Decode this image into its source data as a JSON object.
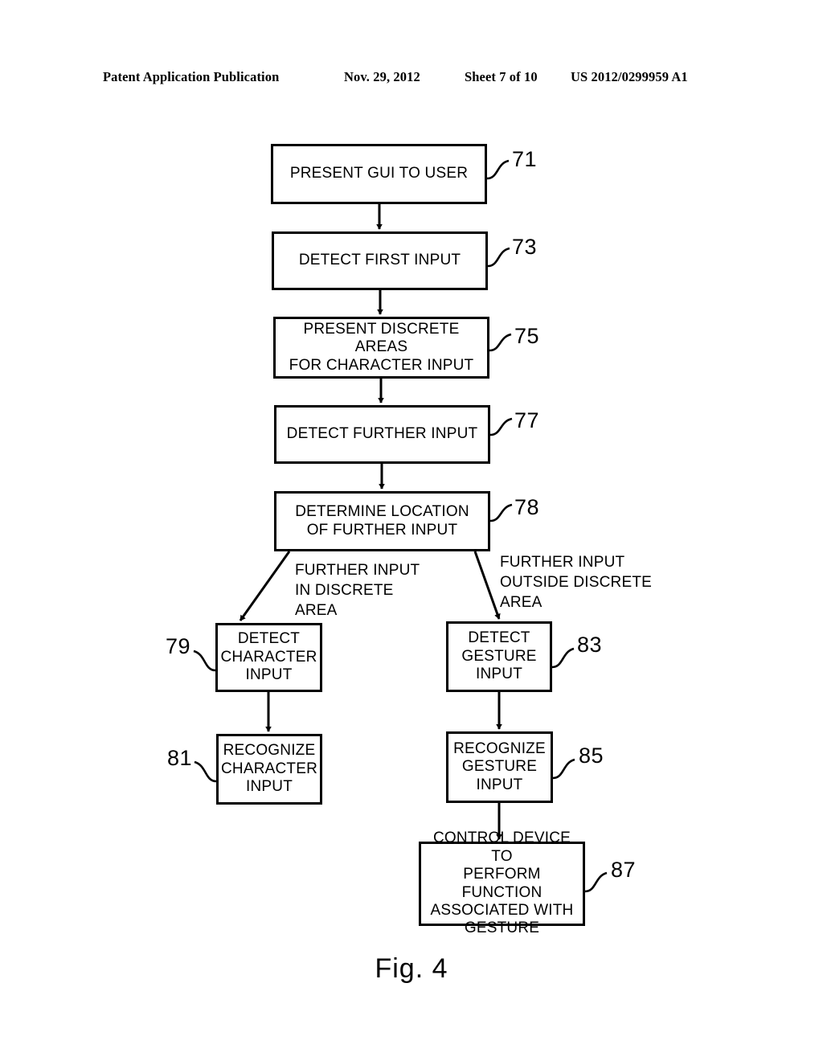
{
  "header": {
    "publication": "Patent Application Publication",
    "date": "Nov. 29, 2012",
    "sheet": "Sheet 7 of 10",
    "publication_number": "US 2012/0299959 A1"
  },
  "figure": {
    "caption": "Fig. 4",
    "type": "flowchart"
  },
  "nodes": [
    {
      "ref": "71",
      "label": "PRESENT GUI TO USER"
    },
    {
      "ref": "73",
      "label": "DETECT FIRST INPUT"
    },
    {
      "ref": "75",
      "label": "PRESENT DISCRETE AREAS\nFOR CHARACTER INPUT"
    },
    {
      "ref": "77",
      "label": "DETECT FURTHER INPUT"
    },
    {
      "ref": "78",
      "label": "DETERMINE LOCATION\nOF FURTHER INPUT"
    },
    {
      "ref": "79",
      "label": "DETECT\nCHARACTER\nINPUT"
    },
    {
      "ref": "81",
      "label": "RECOGNIZE\nCHARACTER\nINPUT"
    },
    {
      "ref": "83",
      "label": "DETECT\nGESTURE\nINPUT"
    },
    {
      "ref": "85",
      "label": "RECOGNIZE\nGESTURE\nINPUT"
    },
    {
      "ref": "87",
      "label": "CONTROL DEVICE TO\nPERFORM FUNCTION\nASSOCIATED WITH\nGESTURE"
    }
  ],
  "branch_labels": {
    "left": "FURTHER INPUT\nIN DISCRETE\nAREA",
    "right": "FURTHER INPUT\nOUTSIDE DISCRETE\nAREA"
  },
  "colors": {
    "ink": "#000000",
    "paper": "#ffffff"
  }
}
